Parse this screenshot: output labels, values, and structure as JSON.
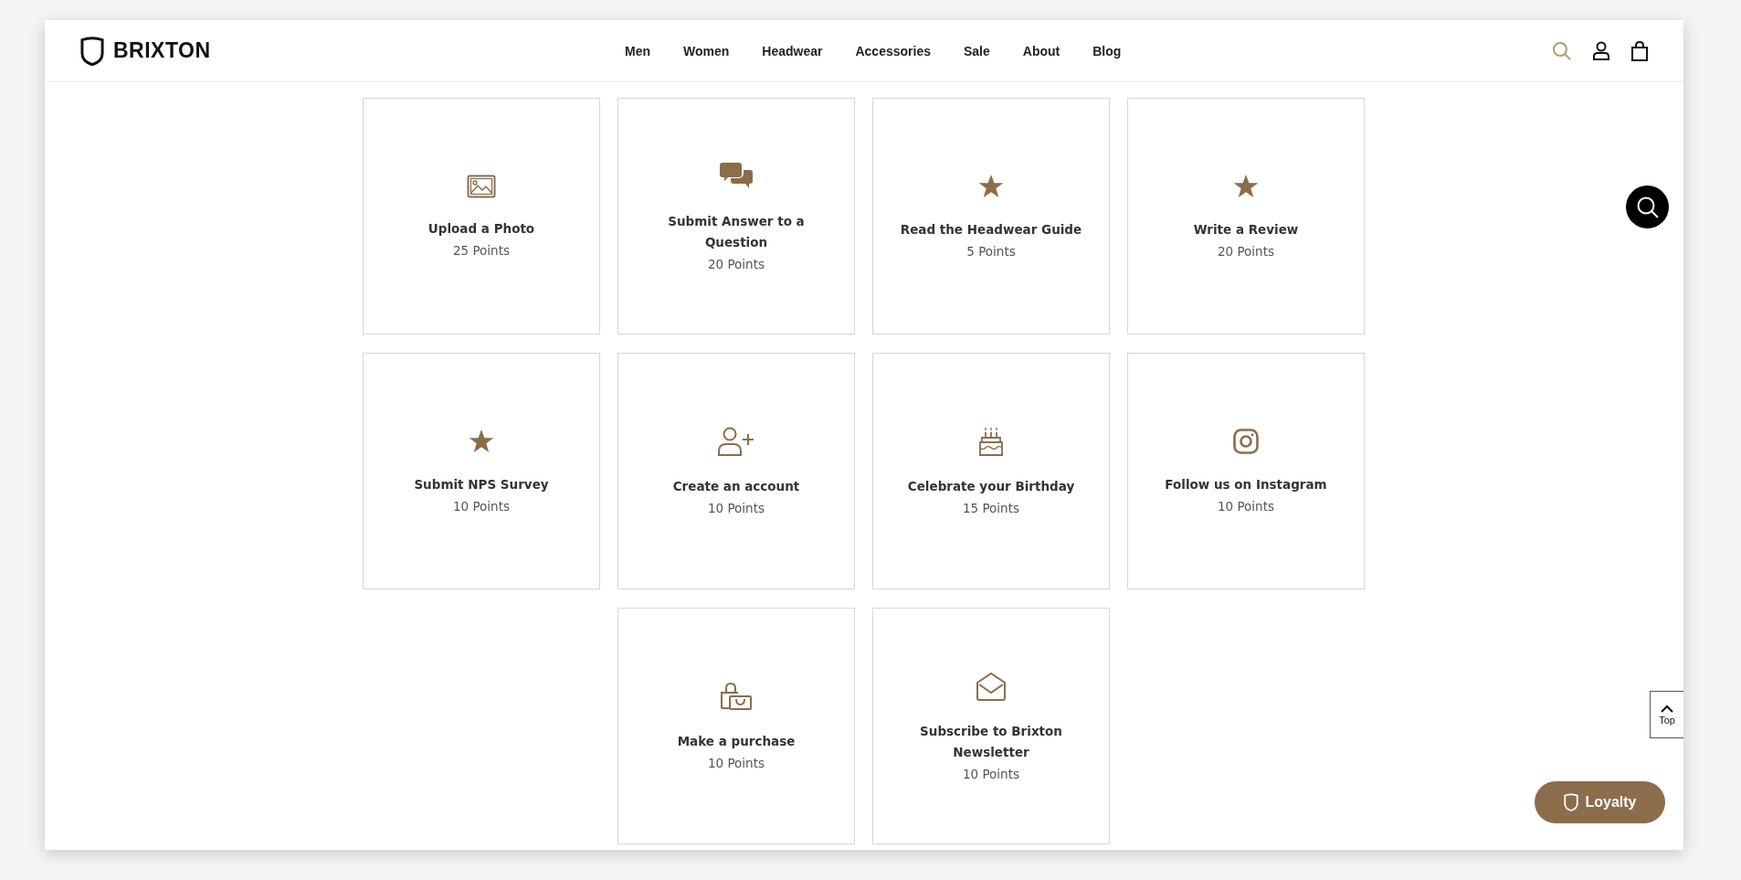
{
  "header": {
    "brand": "BRIXTON",
    "nav": [
      "Men",
      "Women",
      "Headwear",
      "Accessories",
      "Sale",
      "About",
      "Blog"
    ]
  },
  "cards": [
    {
      "kind": "photo",
      "title": "Upload a Photo",
      "points": "25 Points"
    },
    {
      "kind": "chat",
      "title": "Submit Answer to a Question",
      "points": "20 Points"
    },
    {
      "kind": "star",
      "title": "Read the Headwear Guide",
      "points": "5 Points"
    },
    {
      "kind": "star",
      "title": "Write a Review",
      "points": "20 Points"
    },
    {
      "kind": "star",
      "title": "Submit NPS Survey",
      "points": "10 Points"
    },
    {
      "kind": "account",
      "title": "Create an account",
      "points": "10 Points"
    },
    {
      "kind": "birthday",
      "title": "Celebrate your Birthday",
      "points": "15 Points"
    },
    {
      "kind": "social",
      "title": "Follow us on Instagram",
      "points": "10 Points"
    },
    {
      "kind": "purchase",
      "title": "Make a purchase",
      "points": "10 Points"
    },
    {
      "kind": "newsletter",
      "title": "Subscribe to Brixton Newsletter",
      "points": "10 Points"
    }
  ],
  "back_to_top": {
    "label": "Top"
  },
  "loyalty_button": {
    "label": "Loyalty"
  }
}
